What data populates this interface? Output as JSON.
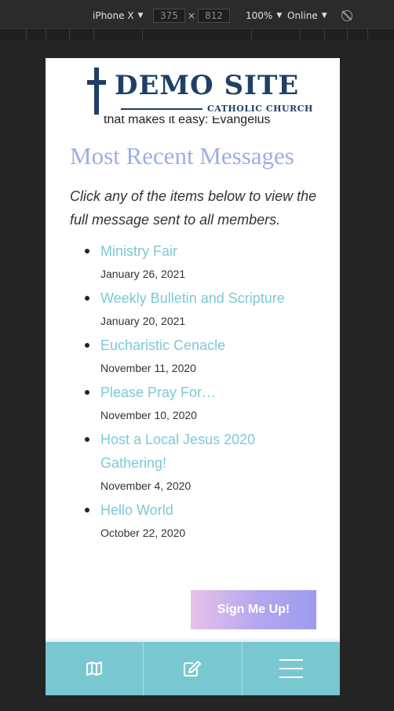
{
  "devtools": {
    "device_name": "iPhone X",
    "width_value": "375",
    "height_value": "812",
    "dimension_separator": "×",
    "zoom": "100%",
    "network": "Online"
  },
  "logo": {
    "title": "DEMO SITE",
    "subtitle": "CATHOLIC CHURCH"
  },
  "page": {
    "cut_text": "that makes it easy: Evangelus",
    "section_title": "Most Recent Messages",
    "intro": "Click any of the items below to view the full message sent to all members."
  },
  "messages": [
    {
      "title": "Ministry Fair",
      "date": "January 26, 2021"
    },
    {
      "title": "Weekly Bulletin and Scripture",
      "date": "January 20, 2021"
    },
    {
      "title": "Eucharistic Cenacle",
      "date": "November 11, 2020"
    },
    {
      "title": "Please Pray For…",
      "date": "November 10, 2020"
    },
    {
      "title": "Host a Local Jesus 2020 Gathering!",
      "date": "November 4, 2020"
    },
    {
      "title": "Hello World",
      "date": "October 22, 2020"
    }
  ],
  "signup": {
    "label": "Sign Me Up!"
  },
  "bottom_nav": {
    "items": [
      {
        "icon": "map-icon"
      },
      {
        "icon": "edit-icon"
      },
      {
        "icon": "hamburger-menu-icon"
      }
    ]
  },
  "colors": {
    "accent_teal": "#79c8d1",
    "link": "#7ccad4",
    "heading": "#9eaee3",
    "logo_navy": "#1f3f66"
  }
}
